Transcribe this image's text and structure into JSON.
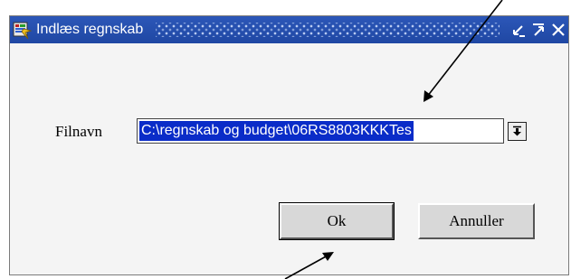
{
  "window": {
    "title": "Indlæs regnskab",
    "icon": "app-icon",
    "title_buttons": [
      "minimize-icon",
      "maximize-icon",
      "close-icon"
    ]
  },
  "form": {
    "filename_label": "Filnavn",
    "filename_value": "C:\\regnskab og budget\\06RS8803KKKTes",
    "dropdown_icon": "dropdown-arrow-icon"
  },
  "buttons": {
    "ok_label": "Ok",
    "cancel_label": "Annuller"
  },
  "colors": {
    "titlebar": "#1f47a3",
    "selection": "#0a2cc8"
  }
}
